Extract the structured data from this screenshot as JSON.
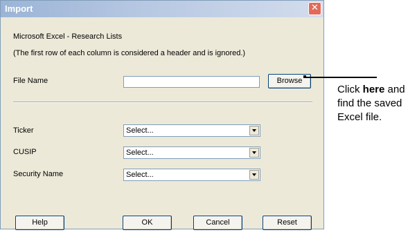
{
  "dialog": {
    "title": "Import",
    "close_glyph": "✕",
    "header_line1": "Microsoft Excel - Research Lists",
    "header_line2": "(The first row of each column is considered a header and is ignored.)",
    "file_name_label": "File Name",
    "file_name_value": "",
    "browse_label": "Browse",
    "fields": [
      {
        "label": "Ticker",
        "value": "Select..."
      },
      {
        "label": "CUSIP",
        "value": "Select..."
      },
      {
        "label": "Security Name",
        "value": "Select..."
      }
    ],
    "buttons": {
      "help": "Help",
      "ok": "OK",
      "cancel": "Cancel",
      "reset": "Reset"
    }
  },
  "callout": {
    "prefix": "Click ",
    "bold": "here",
    "suffix": " and find the saved Excel file."
  },
  "colors": {
    "dialog_bg": "#ece9d8",
    "titlebar": "#9bb4d6",
    "close_button": "#e06b5a"
  },
  "icons": {
    "close": "close-icon",
    "dropdown": "chevron-down-icon"
  }
}
